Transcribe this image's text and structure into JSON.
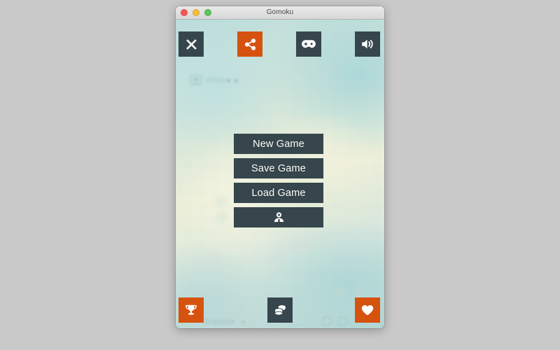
{
  "window": {
    "title": "Gomoku",
    "traffic_lights": [
      {
        "name": "close",
        "color": "#f25a55"
      },
      {
        "name": "minimize",
        "color": "#f6bc3f"
      },
      {
        "name": "maximize",
        "color": "#5ec65a"
      }
    ]
  },
  "theme": {
    "dark": "#36464c",
    "orange": "#d6520f",
    "text_on_dark": "#ffffff",
    "desktop": "#c9c9c9"
  },
  "top_toolbar": {
    "buttons": [
      {
        "id": "close-game",
        "icon": "close-icon",
        "label": "Close",
        "style": "dark"
      },
      {
        "id": "share",
        "icon": "share-icon",
        "label": "Share",
        "style": "orange"
      },
      {
        "id": "controller",
        "icon": "gamepad-icon",
        "label": "Controller",
        "style": "dark"
      },
      {
        "id": "sound",
        "icon": "speaker-icon",
        "label": "Sound",
        "style": "dark"
      }
    ]
  },
  "menu": {
    "items": [
      {
        "id": "new-game",
        "label": "New Game",
        "type": "text"
      },
      {
        "id": "save-game",
        "label": "Save Game",
        "type": "text"
      },
      {
        "id": "load-game",
        "label": "Load Game",
        "type": "text"
      },
      {
        "id": "player",
        "label": "",
        "icon": "person-icon",
        "type": "icon"
      }
    ]
  },
  "bottom_toolbar": {
    "buttons": [
      {
        "id": "achievements",
        "icon": "trophy-icon",
        "label": "Achievements",
        "style": "orange"
      },
      {
        "id": "coins",
        "icon": "coins-icon",
        "label": "Coins",
        "style": "dark"
      },
      {
        "id": "favorites",
        "icon": "heart-icon",
        "label": "Favorites",
        "style": "orange"
      }
    ]
  },
  "background_hud": {
    "player_label": "White",
    "player_stars": "★★",
    "difficulty_label": "Superior"
  }
}
